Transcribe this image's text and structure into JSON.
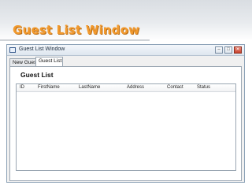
{
  "slide": {
    "title": "Guest List Window"
  },
  "window": {
    "title": "Guest List Window",
    "icons": {
      "app": "window-icon",
      "minimize": "minimize-icon",
      "maximize": "maximize-icon",
      "close": "close-icon"
    },
    "tabs": [
      {
        "label": "New Guest",
        "selected": false
      },
      {
        "label": "Guest List",
        "selected": true
      }
    ],
    "panel": {
      "heading": "Guest List",
      "columns": [
        "ID",
        "FirstName",
        "LastName",
        "Address",
        "Contact",
        "Status"
      ],
      "rows": []
    }
  },
  "colors": {
    "title_accent": "#f29a2e",
    "close_button": "#c8432d"
  }
}
